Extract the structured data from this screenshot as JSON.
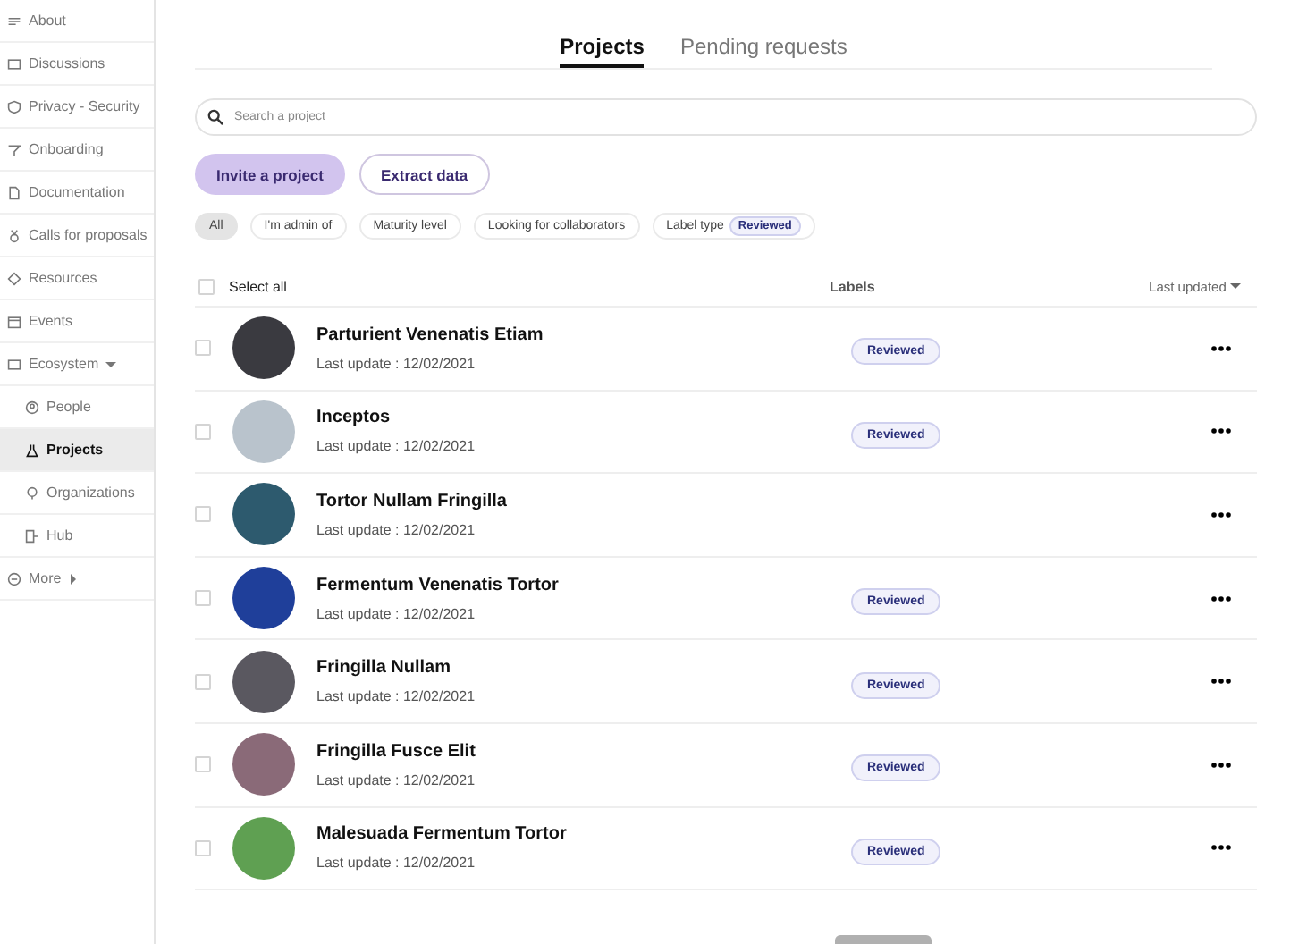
{
  "sidebar": {
    "items": [
      {
        "label": "About",
        "selected": false
      },
      {
        "label": "Discussions",
        "selected": false
      },
      {
        "label": "Privacy - Security",
        "selected": false
      },
      {
        "label": "Onboarding",
        "selected": false
      },
      {
        "label": "Documentation",
        "selected": false
      },
      {
        "label": "Calls for proposals",
        "selected": false
      },
      {
        "label": "Resources",
        "selected": false
      },
      {
        "label": "Events",
        "selected": false
      },
      {
        "label": "Ecosystem",
        "selected": false,
        "expanded": true,
        "children": [
          {
            "label": "People",
            "selected": false
          },
          {
            "label": "Projects",
            "selected": true
          },
          {
            "label": "Organizations",
            "selected": false
          },
          {
            "label": "Hub",
            "selected": false
          }
        ]
      },
      {
        "label": "More",
        "selected": false,
        "expanded": false
      }
    ]
  },
  "tabs": [
    {
      "label": "Projects",
      "selected": true
    },
    {
      "label": "Pending requests",
      "selected": false
    }
  ],
  "search": {
    "placeholder": "Search a project"
  },
  "actions": [
    {
      "label": "Invite a project",
      "kind": "primary"
    },
    {
      "label": "Extract data",
      "kind": "outline"
    }
  ],
  "filters": [
    {
      "label": "All",
      "selected": true
    },
    {
      "label": "I'm admin of",
      "selected": false
    },
    {
      "label": "Maturity level",
      "selected": false
    },
    {
      "label": "Looking for collaborators",
      "selected": false
    },
    {
      "label": "Label type",
      "selected": false,
      "value": "Reviewed"
    }
  ],
  "table": {
    "select_all": {
      "label": "Select all",
      "checked": false
    },
    "labels_header": "Labels",
    "sort": "Last updated",
    "rows": [
      {
        "name": "Parturient Venenatis Etiam",
        "updated": "Last update : 12/02/2021",
        "label": "Reviewed",
        "checked": false,
        "color": "#3a3a40"
      },
      {
        "name": "Inceptos",
        "updated": "Last update : 12/02/2021",
        "label": "Reviewed",
        "checked": false,
        "color": "#b9c3cc"
      },
      {
        "name": "Tortor Nullam Fringilla",
        "updated": "Last update : 12/02/2021",
        "checked": false,
        "color": "#2d5a6e"
      },
      {
        "name": "Fermentum Venenatis Tortor",
        "updated": "Last update : 12/02/2021",
        "label": "Reviewed",
        "checked": false,
        "color": "#1f3f9a"
      },
      {
        "name": "Fringilla Nullam",
        "updated": "Last update : 12/02/2021",
        "label": "Reviewed",
        "checked": false,
        "color": "#5a5860"
      },
      {
        "name": "Fringilla Fusce Elit",
        "updated": "Last update : 12/02/2021",
        "label": "Reviewed",
        "checked": false,
        "color": "#8a6a78"
      },
      {
        "name": "Malesuada Fermentum Tortor",
        "updated": "Last update : 12/02/2021",
        "label": "Reviewed",
        "checked": false,
        "color": "#5fa052"
      }
    ]
  }
}
